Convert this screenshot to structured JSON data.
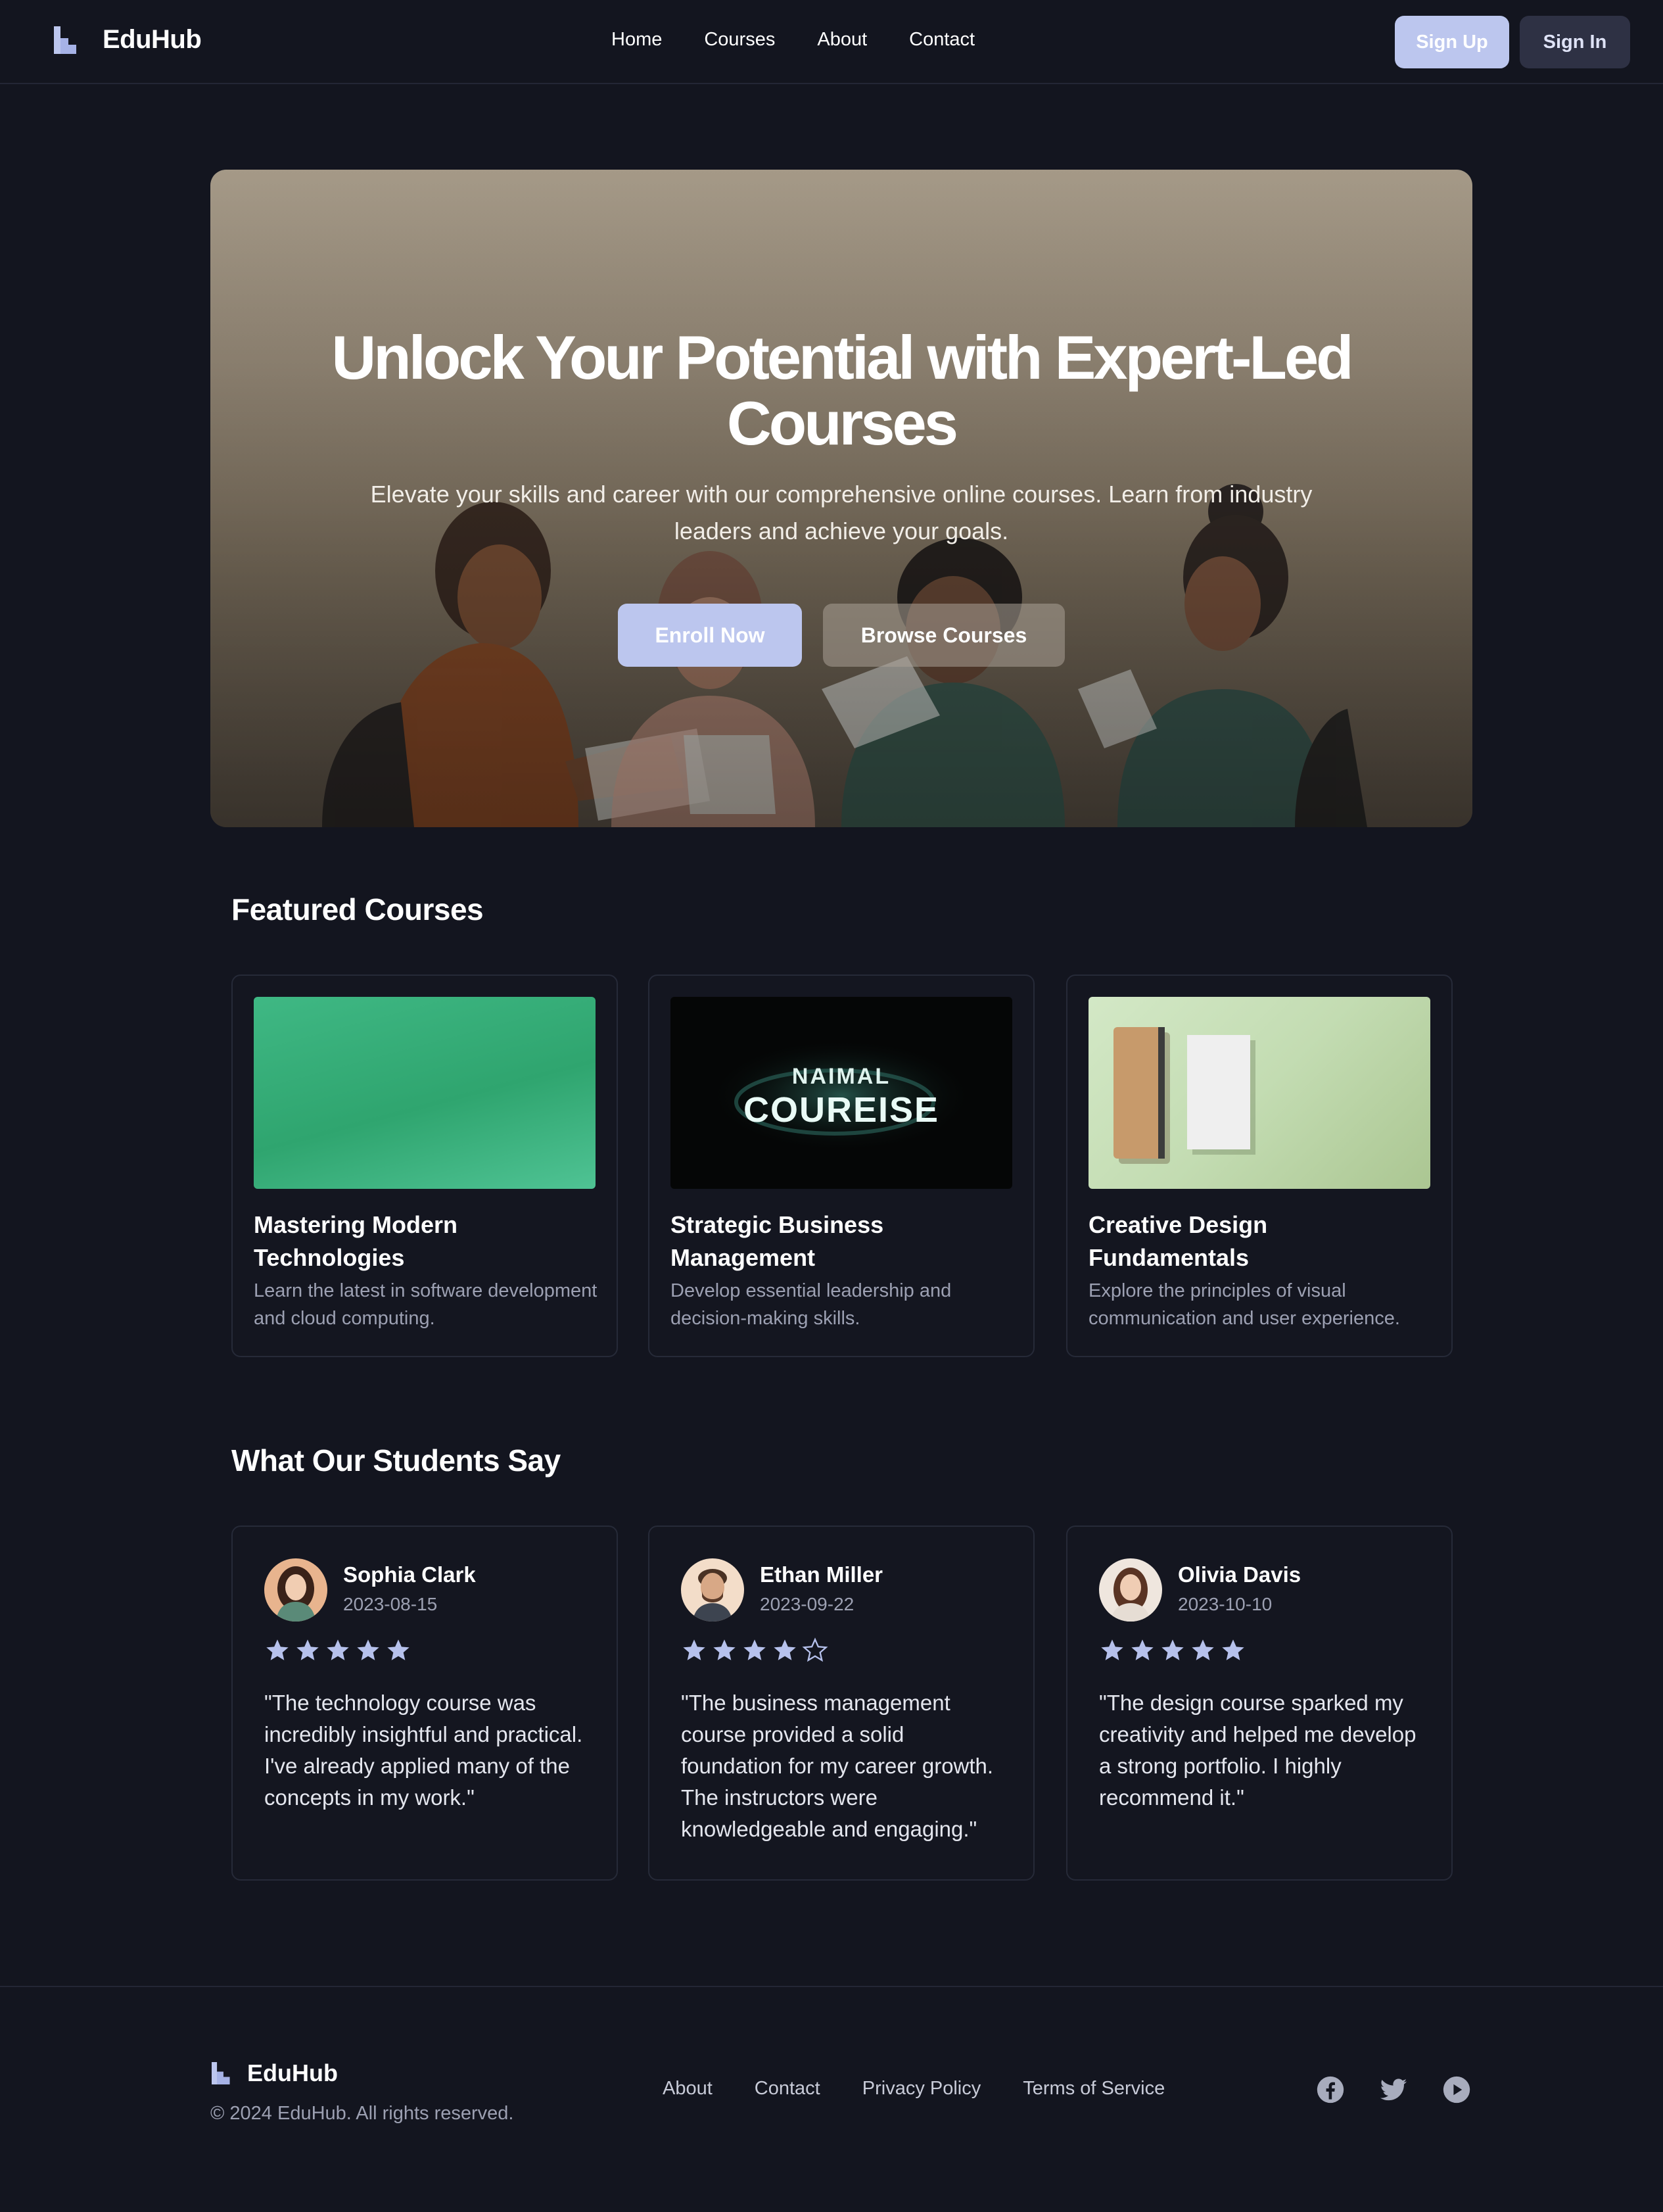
{
  "header": {
    "brand": "EduHub",
    "logo_icon": "stair-logo-icon",
    "nav": [
      "Home",
      "Courses",
      "About",
      "Contact"
    ],
    "sign_up": "Sign Up",
    "sign_in": "Sign In"
  },
  "hero": {
    "title": "Unlock Your Potential with Expert-Led Courses",
    "subtitle": "Elevate your skills and career with our comprehensive online courses. Learn from industry leaders and achieve your goals.",
    "enroll": "Enroll Now",
    "browse": "Browse Courses"
  },
  "featured": {
    "title": "Featured Courses",
    "courses": [
      {
        "title": "Mastering Modern Technologies",
        "desc": "Learn the latest in software development and cloud computing."
      },
      {
        "title": "Strategic Business Management",
        "desc": "Develop essential leadership and decision-making skills.",
        "image_text_top": "NAIMAL",
        "image_text_bottom": "COUREISE"
      },
      {
        "title": "Creative Design Fundamentals",
        "desc": "Explore the principles of visual communication and user experience."
      }
    ]
  },
  "testimonials": {
    "title": "What Our Students Say",
    "items": [
      {
        "name": "Sophia Clark",
        "date": "2023-08-15",
        "rating": 5,
        "quote": "\"The technology course was incredibly insightful and practical. I've already applied many of the concepts in my work.\""
      },
      {
        "name": "Ethan Miller",
        "date": "2023-09-22",
        "rating": 4,
        "quote": "\"The business management course provided a solid foundation for my career growth. The instructors were knowledgeable and engaging.\""
      },
      {
        "name": "Olivia Davis",
        "date": "2023-10-10",
        "rating": 5,
        "quote": "\"The design course sparked my creativity and helped me develop a strong portfolio. I highly recommend it.\""
      }
    ]
  },
  "footer": {
    "brand": "EduHub",
    "copyright": "© 2024 EduHub. All rights reserved.",
    "links": [
      "About",
      "Contact",
      "Privacy Policy",
      "Terms of Service"
    ],
    "social_icons": [
      "facebook-icon",
      "twitter-icon",
      "youtube-icon"
    ]
  },
  "colors": {
    "background": "#13151f",
    "accent": "#bcc6ee",
    "star": "#b6c1ec",
    "muted_text": "#9ca0b2"
  }
}
